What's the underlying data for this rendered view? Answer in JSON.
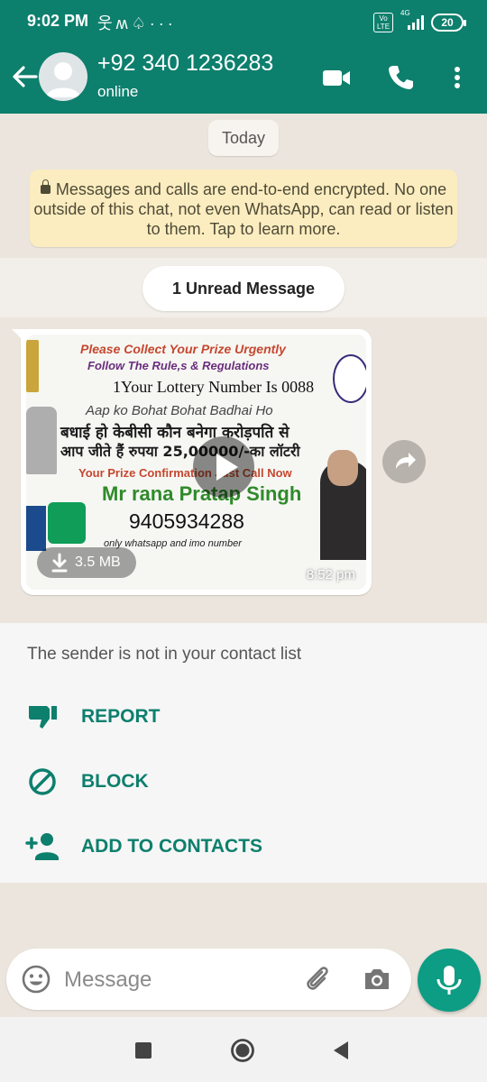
{
  "status_bar": {
    "time": "9:02 PM",
    "icons_left": [
      "stick-figure-icon",
      "m-logo-icon",
      "snapchat-ghost-icon",
      "more-dots-icon"
    ],
    "volte": "Vo LTE",
    "network": "4G",
    "battery": "20"
  },
  "header": {
    "contact": "+92 340 1236283",
    "status": "online"
  },
  "chat": {
    "date_chip": "Today",
    "encryption_notice": "Messages and calls are end-to-end encrypted. No one outside of this chat, not even WhatsApp, can read or listen to them. Tap to learn more.",
    "unread_label": "1 Unread Message",
    "media_message": {
      "size": "3.5 MB",
      "time": "8:52 pm",
      "poster_lines": [
        "Please Collect Your Prize Urgently",
        "Follow The Rule,s & Regulations",
        "1Your Lottery Number Is 0088",
        "Aap ko Bohat Bohat Badhai Ho",
        "बधाई हो केबीसी कौन बनेगा करोड़पति से",
        "आप जीते हैं रुपया 25,00000/-का लॉटरी",
        "Your Prize Confirmation Just Call Now",
        "Mr rana Pratap Singh",
        "9405934288",
        "only whatsapp and imo number"
      ]
    }
  },
  "unknown_panel": {
    "note": "The sender is not in your contact list",
    "actions": [
      "REPORT",
      "BLOCK",
      "ADD TO CONTACTS"
    ]
  },
  "composer": {
    "placeholder": "Message"
  },
  "colors": {
    "brand": "#0d7f6d",
    "mic": "#0d9c84",
    "chat_bg": "#ece5dd",
    "encryption_bg": "#fbedc0"
  }
}
